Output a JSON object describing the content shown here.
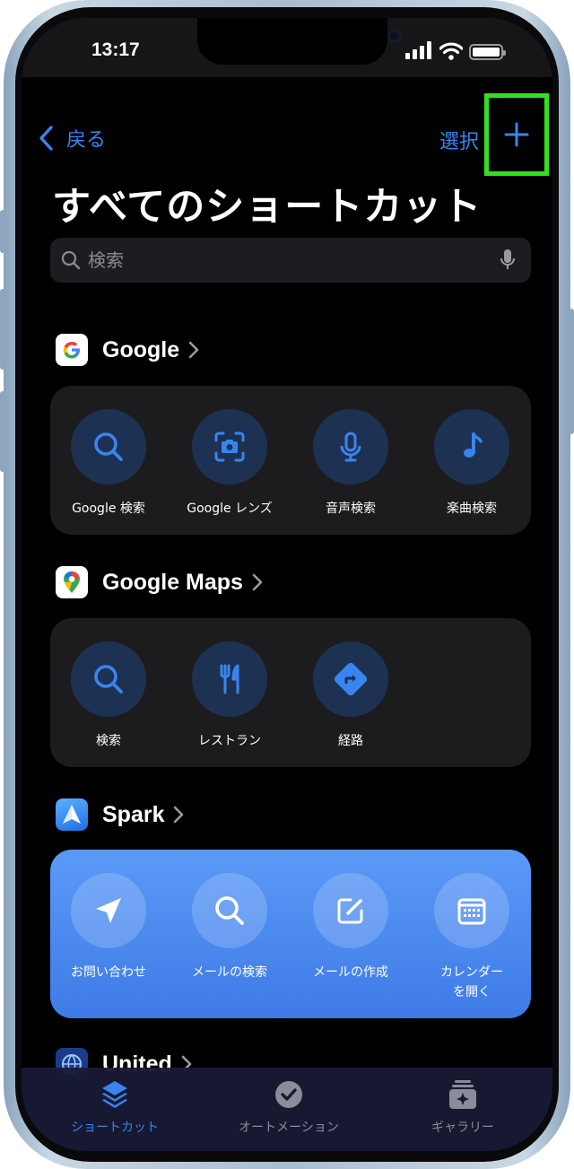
{
  "status": {
    "time": "13:17"
  },
  "nav": {
    "back_label": "戻る",
    "select_label": "選択"
  },
  "page": {
    "title": "すべてのショートカット"
  },
  "search": {
    "placeholder": "検索"
  },
  "sections": [
    {
      "title": "Google",
      "actions": [
        {
          "label": "Google 検索",
          "icon": "search-icon"
        },
        {
          "label": "Google レンズ",
          "icon": "lens-camera-icon"
        },
        {
          "label": "音声検索",
          "icon": "microphone-icon"
        },
        {
          "label": "楽曲検索",
          "icon": "music-note-icon"
        }
      ]
    },
    {
      "title": "Google Maps",
      "actions": [
        {
          "label": "検索",
          "icon": "search-icon"
        },
        {
          "label": "レストラン",
          "icon": "fork-knife-icon"
        },
        {
          "label": "経路",
          "icon": "directions-icon"
        }
      ]
    },
    {
      "title": "Spark",
      "actions": [
        {
          "label": "お問い合わせ",
          "icon": "send-icon"
        },
        {
          "label": "メールの検索",
          "icon": "search-icon"
        },
        {
          "label": "メールの作成",
          "icon": "compose-icon"
        },
        {
          "label": "カレンダー\nを開く",
          "icon": "calendar-icon"
        }
      ]
    },
    {
      "title": "United"
    }
  ],
  "tabs": [
    {
      "label": "ショートカット",
      "icon": "layers-icon",
      "active": true
    },
    {
      "label": "オートメーション",
      "icon": "clock-check-icon",
      "active": false
    },
    {
      "label": "ギャラリー",
      "icon": "gallery-sparkle-icon",
      "active": false
    }
  ],
  "colors": {
    "accent": "#3a84f0",
    "highlight": "#35e01f",
    "spark_card": "#4a88ee",
    "tab_bar": "#181a34"
  }
}
